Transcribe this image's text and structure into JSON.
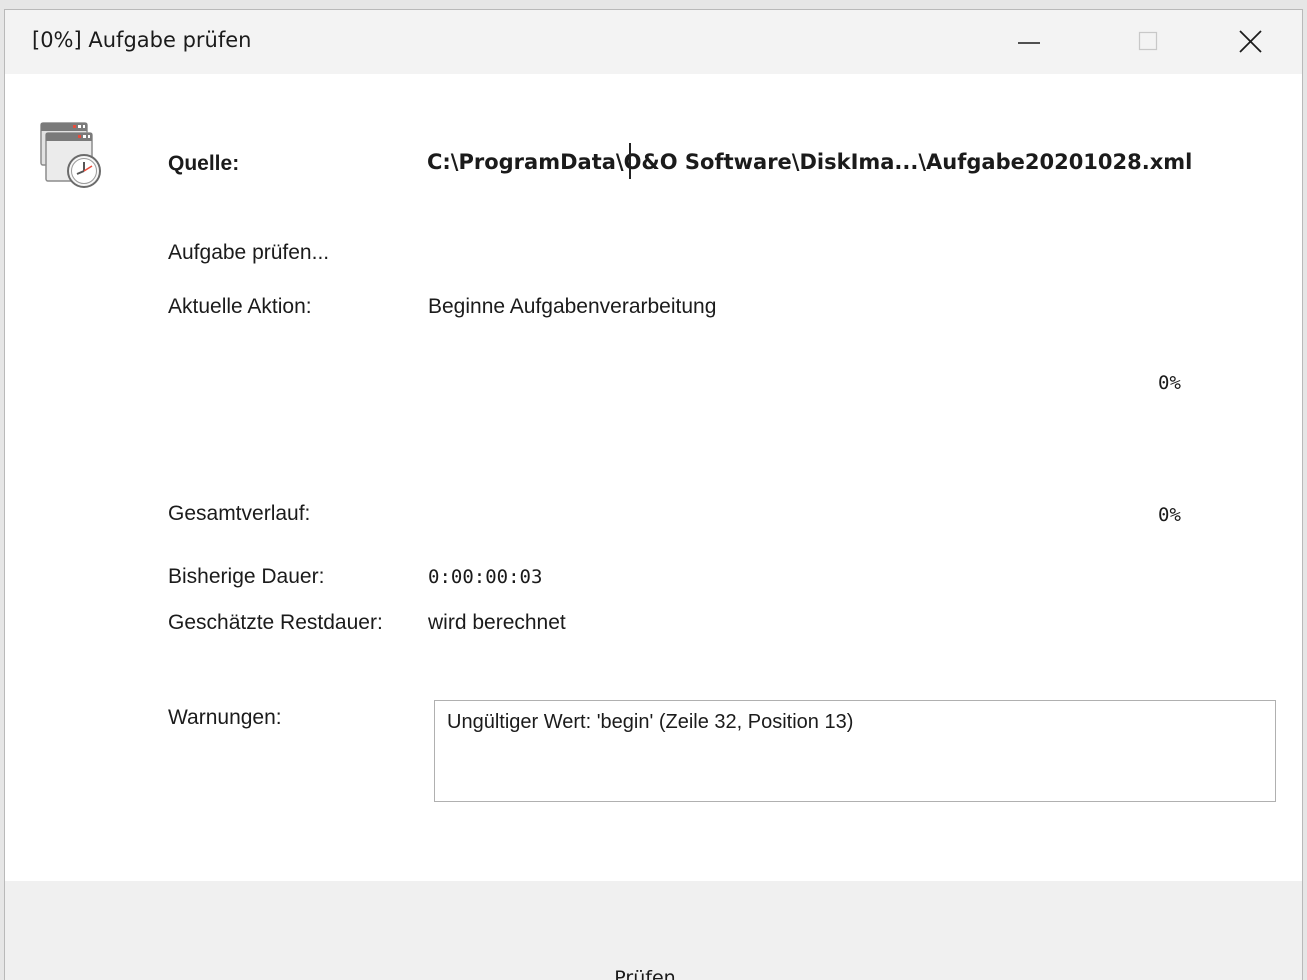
{
  "window": {
    "title": "[0%] Aufgabe prüfen",
    "controls": {
      "minimize": "minimize-icon",
      "maximize": "maximize-icon",
      "close": "close-icon"
    }
  },
  "app_icon": "scheduled-task-clock-icon",
  "source": {
    "label": "Quelle:",
    "path": "C:\\ProgramData\\O&O Software\\DiskIma...\\Aufgabe20201028.xml"
  },
  "status": {
    "heading": "Aufgabe prüfen...",
    "current_action_label": "Aktuelle Aktion:",
    "current_action_value": "Beginne Aufgabenverarbeitung",
    "current_progress_percent": "0%",
    "total_progress_label": "Gesamtverlauf:",
    "total_progress_percent": "0%",
    "elapsed_label": "Bisherige Dauer:",
    "elapsed_value": "0:00:00:03",
    "remaining_label": "Geschätzte Restdauer:",
    "remaining_value": "wird berechnet"
  },
  "warnings": {
    "label": "Warnungen:",
    "text": "Ungültiger Wert: 'begin' (Zeile 32, Position 13)"
  },
  "footer": {
    "button_label": "Prüfen"
  },
  "colors": {
    "titlebar": "#f3f3f3",
    "window_bg": "#ffffff",
    "footer_bg": "#f0f0f0"
  }
}
